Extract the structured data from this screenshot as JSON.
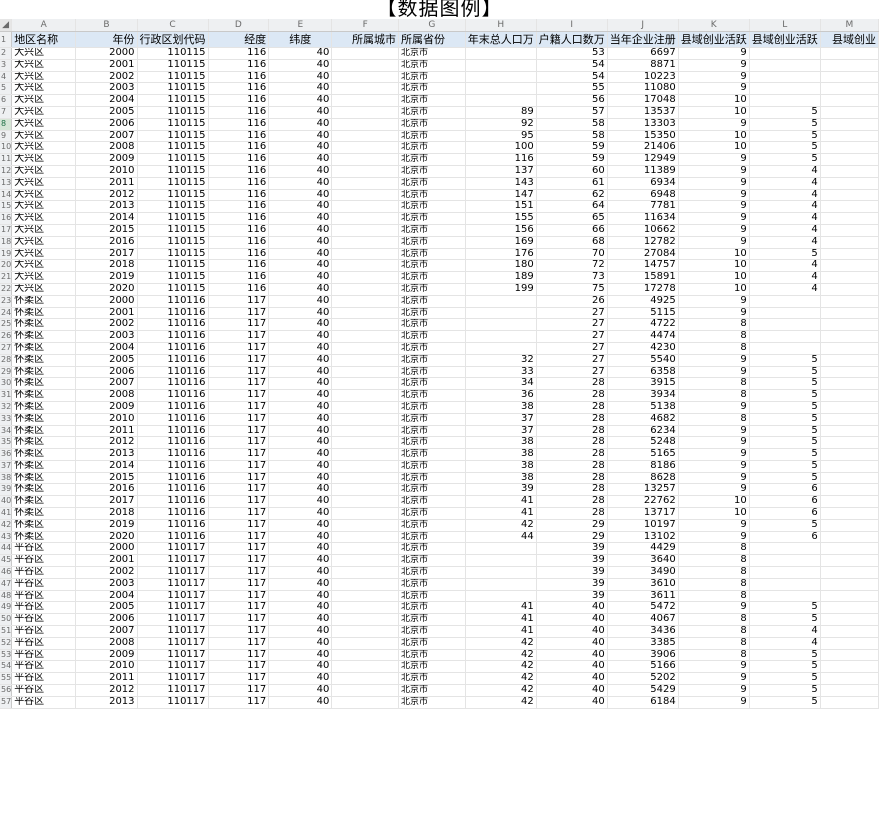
{
  "title": "【数据图例】",
  "col_letters": [
    "A",
    "B",
    "C",
    "D",
    "E",
    "F",
    "G",
    "H",
    "I",
    "J",
    "K",
    "L",
    "M"
  ],
  "headers": [
    "地区名称",
    "年份",
    "行政区划代码",
    "经度",
    "纬度",
    "所属城市",
    "所属省份",
    "年末总人口万",
    "户籍人口数万",
    "当年企业注册",
    "县域创业活跃",
    "县域创业活跃",
    "县域创业"
  ],
  "rows": [
    [
      "2",
      "大兴区",
      "2000",
      "110115",
      "116",
      "40",
      "",
      "北京市",
      "",
      "53",
      "6697",
      "9",
      "",
      ""
    ],
    [
      "3",
      "大兴区",
      "2001",
      "110115",
      "116",
      "40",
      "",
      "北京市",
      "",
      "54",
      "8871",
      "9",
      "",
      ""
    ],
    [
      "4",
      "大兴区",
      "2002",
      "110115",
      "116",
      "40",
      "",
      "北京市",
      "",
      "54",
      "10223",
      "9",
      "",
      ""
    ],
    [
      "5",
      "大兴区",
      "2003",
      "110115",
      "116",
      "40",
      "",
      "北京市",
      "",
      "55",
      "11080",
      "9",
      "",
      ""
    ],
    [
      "6",
      "大兴区",
      "2004",
      "110115",
      "116",
      "40",
      "",
      "北京市",
      "",
      "56",
      "17048",
      "10",
      "",
      ""
    ],
    [
      "7",
      "大兴区",
      "2005",
      "110115",
      "116",
      "40",
      "",
      "北京市",
      "89",
      "57",
      "13537",
      "10",
      "5",
      ""
    ],
    [
      "8",
      "大兴区",
      "2006",
      "110115",
      "116",
      "40",
      "",
      "北京市",
      "92",
      "58",
      "13303",
      "9",
      "5",
      ""
    ],
    [
      "9",
      "大兴区",
      "2007",
      "110115",
      "116",
      "40",
      "",
      "北京市",
      "95",
      "58",
      "15350",
      "10",
      "5",
      ""
    ],
    [
      "10",
      "大兴区",
      "2008",
      "110115",
      "116",
      "40",
      "",
      "北京市",
      "100",
      "59",
      "21406",
      "10",
      "5",
      ""
    ],
    [
      "11",
      "大兴区",
      "2009",
      "110115",
      "116",
      "40",
      "",
      "北京市",
      "116",
      "59",
      "12949",
      "9",
      "5",
      ""
    ],
    [
      "12",
      "大兴区",
      "2010",
      "110115",
      "116",
      "40",
      "",
      "北京市",
      "137",
      "60",
      "11389",
      "9",
      "4",
      ""
    ],
    [
      "13",
      "大兴区",
      "2011",
      "110115",
      "116",
      "40",
      "",
      "北京市",
      "143",
      "61",
      "6934",
      "9",
      "4",
      ""
    ],
    [
      "14",
      "大兴区",
      "2012",
      "110115",
      "116",
      "40",
      "",
      "北京市",
      "147",
      "62",
      "6948",
      "9",
      "4",
      ""
    ],
    [
      "15",
      "大兴区",
      "2013",
      "110115",
      "116",
      "40",
      "",
      "北京市",
      "151",
      "64",
      "7781",
      "9",
      "4",
      ""
    ],
    [
      "16",
      "大兴区",
      "2014",
      "110115",
      "116",
      "40",
      "",
      "北京市",
      "155",
      "65",
      "11634",
      "9",
      "4",
      ""
    ],
    [
      "17",
      "大兴区",
      "2015",
      "110115",
      "116",
      "40",
      "",
      "北京市",
      "156",
      "66",
      "10662",
      "9",
      "4",
      ""
    ],
    [
      "18",
      "大兴区",
      "2016",
      "110115",
      "116",
      "40",
      "",
      "北京市",
      "169",
      "68",
      "12782",
      "9",
      "4",
      ""
    ],
    [
      "19",
      "大兴区",
      "2017",
      "110115",
      "116",
      "40",
      "",
      "北京市",
      "176",
      "70",
      "27084",
      "10",
      "5",
      ""
    ],
    [
      "20",
      "大兴区",
      "2018",
      "110115",
      "116",
      "40",
      "",
      "北京市",
      "180",
      "72",
      "14757",
      "10",
      "4",
      ""
    ],
    [
      "21",
      "大兴区",
      "2019",
      "110115",
      "116",
      "40",
      "",
      "北京市",
      "189",
      "73",
      "15891",
      "10",
      "4",
      ""
    ],
    [
      "22",
      "大兴区",
      "2020",
      "110115",
      "116",
      "40",
      "",
      "北京市",
      "199",
      "75",
      "17278",
      "10",
      "4",
      ""
    ],
    [
      "23",
      "怀柔区",
      "2000",
      "110116",
      "117",
      "40",
      "",
      "北京市",
      "",
      "26",
      "4925",
      "9",
      "",
      ""
    ],
    [
      "24",
      "怀柔区",
      "2001",
      "110116",
      "117",
      "40",
      "",
      "北京市",
      "",
      "27",
      "5115",
      "9",
      "",
      ""
    ],
    [
      "25",
      "怀柔区",
      "2002",
      "110116",
      "117",
      "40",
      "",
      "北京市",
      "",
      "27",
      "4722",
      "8",
      "",
      ""
    ],
    [
      "26",
      "怀柔区",
      "2003",
      "110116",
      "117",
      "40",
      "",
      "北京市",
      "",
      "27",
      "4474",
      "8",
      "",
      ""
    ],
    [
      "27",
      "怀柔区",
      "2004",
      "110116",
      "117",
      "40",
      "",
      "北京市",
      "",
      "27",
      "4230",
      "8",
      "",
      ""
    ],
    [
      "28",
      "怀柔区",
      "2005",
      "110116",
      "117",
      "40",
      "",
      "北京市",
      "32",
      "27",
      "5540",
      "9",
      "5",
      ""
    ],
    [
      "29",
      "怀柔区",
      "2006",
      "110116",
      "117",
      "40",
      "",
      "北京市",
      "33",
      "27",
      "6358",
      "9",
      "5",
      ""
    ],
    [
      "30",
      "怀柔区",
      "2007",
      "110116",
      "117",
      "40",
      "",
      "北京市",
      "34",
      "28",
      "3915",
      "8",
      "5",
      ""
    ],
    [
      "31",
      "怀柔区",
      "2008",
      "110116",
      "117",
      "40",
      "",
      "北京市",
      "36",
      "28",
      "3934",
      "8",
      "5",
      ""
    ],
    [
      "32",
      "怀柔区",
      "2009",
      "110116",
      "117",
      "40",
      "",
      "北京市",
      "38",
      "28",
      "5138",
      "9",
      "5",
      ""
    ],
    [
      "33",
      "怀柔区",
      "2010",
      "110116",
      "117",
      "40",
      "",
      "北京市",
      "37",
      "28",
      "4682",
      "8",
      "5",
      ""
    ],
    [
      "34",
      "怀柔区",
      "2011",
      "110116",
      "117",
      "40",
      "",
      "北京市",
      "37",
      "28",
      "6234",
      "9",
      "5",
      ""
    ],
    [
      "35",
      "怀柔区",
      "2012",
      "110116",
      "117",
      "40",
      "",
      "北京市",
      "38",
      "28",
      "5248",
      "9",
      "5",
      ""
    ],
    [
      "36",
      "怀柔区",
      "2013",
      "110116",
      "117",
      "40",
      "",
      "北京市",
      "38",
      "28",
      "5165",
      "9",
      "5",
      ""
    ],
    [
      "37",
      "怀柔区",
      "2014",
      "110116",
      "117",
      "40",
      "",
      "北京市",
      "38",
      "28",
      "8186",
      "9",
      "5",
      ""
    ],
    [
      "38",
      "怀柔区",
      "2015",
      "110116",
      "117",
      "40",
      "",
      "北京市",
      "38",
      "28",
      "8628",
      "9",
      "5",
      ""
    ],
    [
      "39",
      "怀柔区",
      "2016",
      "110116",
      "117",
      "40",
      "",
      "北京市",
      "39",
      "28",
      "13257",
      "9",
      "6",
      ""
    ],
    [
      "40",
      "怀柔区",
      "2017",
      "110116",
      "117",
      "40",
      "",
      "北京市",
      "41",
      "28",
      "22762",
      "10",
      "6",
      ""
    ],
    [
      "41",
      "怀柔区",
      "2018",
      "110116",
      "117",
      "40",
      "",
      "北京市",
      "41",
      "28",
      "13717",
      "10",
      "6",
      ""
    ],
    [
      "42",
      "怀柔区",
      "2019",
      "110116",
      "117",
      "40",
      "",
      "北京市",
      "42",
      "29",
      "10197",
      "9",
      "5",
      ""
    ],
    [
      "43",
      "怀柔区",
      "2020",
      "110116",
      "117",
      "40",
      "",
      "北京市",
      "44",
      "29",
      "13102",
      "9",
      "6",
      ""
    ],
    [
      "44",
      "平谷区",
      "2000",
      "110117",
      "117",
      "40",
      "",
      "北京市",
      "",
      "39",
      "4429",
      "8",
      "",
      ""
    ],
    [
      "45",
      "平谷区",
      "2001",
      "110117",
      "117",
      "40",
      "",
      "北京市",
      "",
      "39",
      "3640",
      "8",
      "",
      ""
    ],
    [
      "46",
      "平谷区",
      "2002",
      "110117",
      "117",
      "40",
      "",
      "北京市",
      "",
      "39",
      "3490",
      "8",
      "",
      ""
    ],
    [
      "47",
      "平谷区",
      "2003",
      "110117",
      "117",
      "40",
      "",
      "北京市",
      "",
      "39",
      "3610",
      "8",
      "",
      ""
    ],
    [
      "48",
      "平谷区",
      "2004",
      "110117",
      "117",
      "40",
      "",
      "北京市",
      "",
      "39",
      "3611",
      "8",
      "",
      ""
    ],
    [
      "49",
      "平谷区",
      "2005",
      "110117",
      "117",
      "40",
      "",
      "北京市",
      "41",
      "40",
      "5472",
      "9",
      "5",
      ""
    ],
    [
      "50",
      "平谷区",
      "2006",
      "110117",
      "117",
      "40",
      "",
      "北京市",
      "41",
      "40",
      "4067",
      "8",
      "5",
      ""
    ],
    [
      "51",
      "平谷区",
      "2007",
      "110117",
      "117",
      "40",
      "",
      "北京市",
      "41",
      "40",
      "3436",
      "8",
      "4",
      ""
    ],
    [
      "52",
      "平谷区",
      "2008",
      "110117",
      "117",
      "40",
      "",
      "北京市",
      "42",
      "40",
      "3385",
      "8",
      "4",
      ""
    ],
    [
      "53",
      "平谷区",
      "2009",
      "110117",
      "117",
      "40",
      "",
      "北京市",
      "42",
      "40",
      "3906",
      "8",
      "5",
      ""
    ],
    [
      "54",
      "平谷区",
      "2010",
      "110117",
      "117",
      "40",
      "",
      "北京市",
      "42",
      "40",
      "5166",
      "9",
      "5",
      ""
    ],
    [
      "55",
      "平谷区",
      "2011",
      "110117",
      "117",
      "40",
      "",
      "北京市",
      "42",
      "40",
      "5202",
      "9",
      "5",
      ""
    ],
    [
      "56",
      "平谷区",
      "2012",
      "110117",
      "117",
      "40",
      "",
      "北京市",
      "42",
      "40",
      "5429",
      "9",
      "5",
      ""
    ],
    [
      "57",
      "平谷区",
      "2013",
      "110117",
      "117",
      "40",
      "",
      "北京市",
      "42",
      "40",
      "6184",
      "9",
      "5",
      ""
    ]
  ]
}
